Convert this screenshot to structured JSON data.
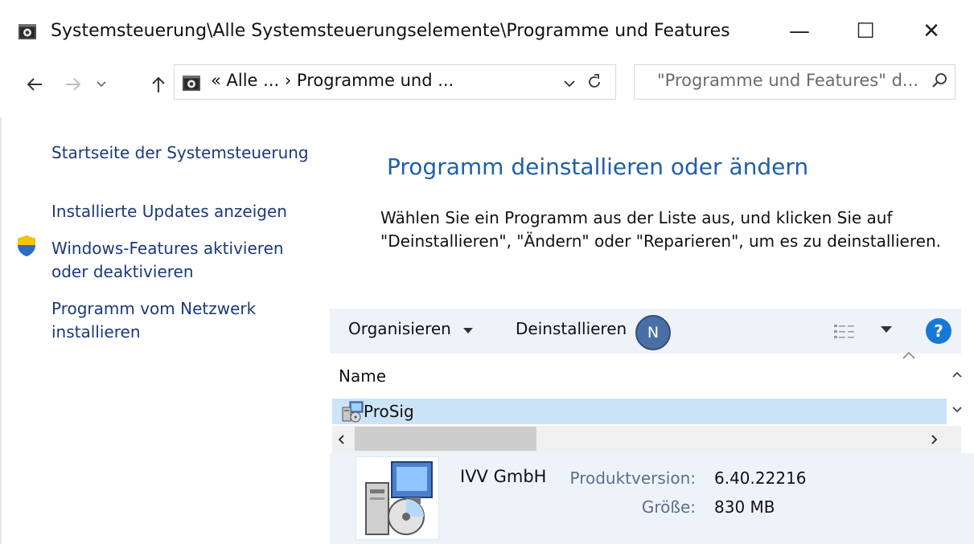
{
  "window": {
    "title": "Systemsteuerung\\Alle Systemsteuerungselemente\\Programme und Features",
    "minimize_glyph": "—",
    "maximize_glyph": "☐",
    "close_glyph": "✕"
  },
  "address": {
    "path_text": "«  Alle ...  ›  Programme und ...",
    "search_placeholder": "\"Programme und Features\" d..."
  },
  "sidebar": {
    "items": [
      {
        "label": "Startseite der Systemsteuerung"
      },
      {
        "label": "Installierte Updates anzeigen"
      },
      {
        "label": "Windows-Features aktivieren oder deaktivieren",
        "icon": "uac-shield-icon"
      },
      {
        "label": "Programm vom Netzwerk installieren"
      }
    ]
  },
  "main": {
    "title": "Programm deinstallieren oder ändern",
    "description": "Wählen Sie ein Programm aus der Liste aus, und klicken Sie auf \"Deinstallieren\", \"Ändern\" oder \"Reparieren\", um es zu deinstallieren."
  },
  "toolbar": {
    "organize_label": "Organisieren",
    "uninstall_label": "Deinstallieren",
    "badge_letter": "N",
    "help_label": "?"
  },
  "list": {
    "columns": [
      "Name"
    ],
    "rows": [
      {
        "name": "ProSig",
        "selected": true
      }
    ]
  },
  "details": {
    "publisher": "IVV GmbH",
    "version_label": "Produktversion:",
    "version_value": "6.40.22216",
    "size_label": "Größe:",
    "size_value": "830 MB"
  },
  "colors": {
    "link": "#1b3a7a",
    "heading": "#1f5fa8",
    "selection": "#cce4f7",
    "toolbar_bg": "#eef3fa",
    "help": "#1778d8",
    "uac_blue": "#2b6cc4",
    "uac_yellow": "#f5c400"
  }
}
